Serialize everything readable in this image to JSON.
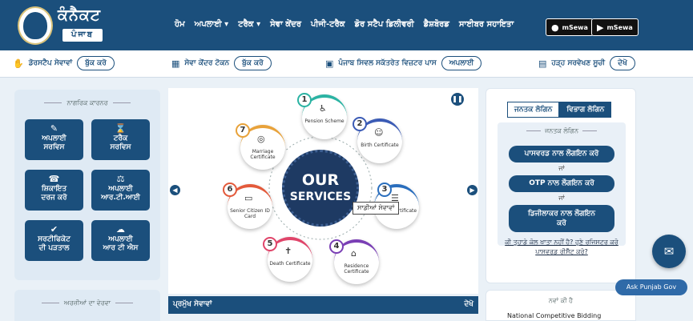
{
  "header": {
    "logo_title": "ਕੰਨੈਕਟ",
    "logo_sub": "ਪੰਜਾਬ",
    "nav": [
      "ਹੋਮ",
      "ਅਪਲਾਈ ▾",
      "ਟਰੈਕ ▾",
      "ਸੇਵਾ ਕੇਂਦਰ",
      "ਪੀਜੀ-ਟਰੈਕ",
      "ਡੋਰ ਸਟੈਪ ਡਿਲੀਵਰੀ",
      "ਡੈਸ਼ਬੋਰਡ",
      "ਸਾਈਬਰ ਸਹਾਇਤਾ"
    ],
    "store_apple": "mSewa",
    "store_play": "mSewa"
  },
  "quickbar": {
    "doorstep": {
      "label": "ਡੋਰਸਟੈਪ ਸੇਵਾਵਾਂ",
      "button": "ਬੁੱਕ ਕਰੋ"
    },
    "token": {
      "label": "ਸੇਵਾ ਕੇਂਦਰ ਟੋਕਨ",
      "button": "ਬੁੱਕ ਕਰੋ"
    },
    "pass": {
      "label": "ਪੰਜਾਬ ਸਿਵਲ ਸਕੱਤਰੇਤ ਵਿਜ਼ਟਰ ਪਾਸ",
      "button": "ਅਪਲਾਈ"
    },
    "list": {
      "label": "ਹੜ੍ਹ ਸਰਵੇਖਣ ਸੂਚੀ",
      "button": "ਦੇਖੋ"
    }
  },
  "citizen_panel": {
    "heading": "ਨਾਗਰਿਕ ਕਾਰਨਰ",
    "tiles": [
      {
        "l1": "ਅਪਲਾਈ",
        "l2": "ਸਰਵਿਸ"
      },
      {
        "l1": "ਟਰੈਕ",
        "l2": "ਸਰਵਿਸ"
      },
      {
        "l1": "ਸ਼ਿਕਾਇਤ",
        "l2": "ਦਰਜ ਕਰੋ"
      },
      {
        "l1": "ਅਪਲਾਈ",
        "l2": "ਆਰ.ਟੀ.ਆਈ"
      },
      {
        "l1": "ਸਰਟੀਫਿਕੇਟ",
        "l2": "ਦੀ ਪੜਤਾਲ"
      },
      {
        "l1": "ਅਪਲਾਈ",
        "l2": "ਆਰ ਟੀ ਐਸ"
      }
    ],
    "second_heading": "ਅਰਜ਼ੀਆਂ ਦਾ ਵੇਰਵਾ"
  },
  "carousel": {
    "center_l1": "OUR",
    "center_l2": "SERVICES",
    "tooltip": "ਸਾਡੀਆਂ ਸੇਵਾਵਾਂ",
    "services": [
      {
        "num": "1",
        "name": "Pension Scheme"
      },
      {
        "num": "2",
        "name": "Birth Certificate"
      },
      {
        "num": "3",
        "name": "Caste Certificate"
      },
      {
        "num": "4",
        "name": "Residence Certificate"
      },
      {
        "num": "5",
        "name": "Death Certificate"
      },
      {
        "num": "6",
        "name": "Senior Citizen ID Card"
      },
      {
        "num": "7",
        "name": "Marriage Certificate"
      }
    ],
    "strip_left": "ਪ੍ਰਮੁੱਖ ਸੇਵਾਵਾਂ",
    "strip_right": "ਦੇਖੋ",
    "colors": {
      "center": "#1e3a63",
      "s1": "#2bb3a3",
      "s2": "#3b5bb5",
      "s3": "#2a6ebd",
      "s4": "#7a3fb5",
      "s5": "#e0456a",
      "s6": "#e35a3b",
      "s7": "#e8a23a"
    }
  },
  "login": {
    "tab_citizen": "ਜਨਤਕ ਲੋਗਿਨ",
    "tab_dept": "ਵਿਭਾਗ ਲੋਗਿਨ",
    "heading": "ਜਨਤਕ ਲੋਗਿਨ",
    "btn_password": "ਪਾਸਵਰਡ ਨਾਲ ਲੌਗਇਨ ਕਰੋ",
    "or1": "ਜਾਂ",
    "btn_otp": "OTP ਨਾਲ ਲੌਗਇਨ ਕਰੋ",
    "or2": "ਜਾਂ",
    "btn_digilocker_l1": "ਡਿਜੀਲਾਕਰ ਨਾਲ ਲੌਗਇਨ",
    "btn_digilocker_l2": "ਕਰੋ",
    "register_l1": "ਕੀ ਤੁਹਾਡੇ ਕੋਲ ਖਾਤਾ ਨਹੀਂ ਹੈ? ਹੁਣੇ ਰਜਿਸਟਰ ਕਰੋ",
    "register_l2": "ਪਾਸਵਰਡ ਰੀਸੈੱਟ ਕਰੋ?"
  },
  "news": {
    "heading": "ਨਵਾਂ ਕੀ ਹੈ",
    "item": "National Competitive Bidding"
  },
  "chat": {
    "ask": "Ask Punjab Gov"
  }
}
